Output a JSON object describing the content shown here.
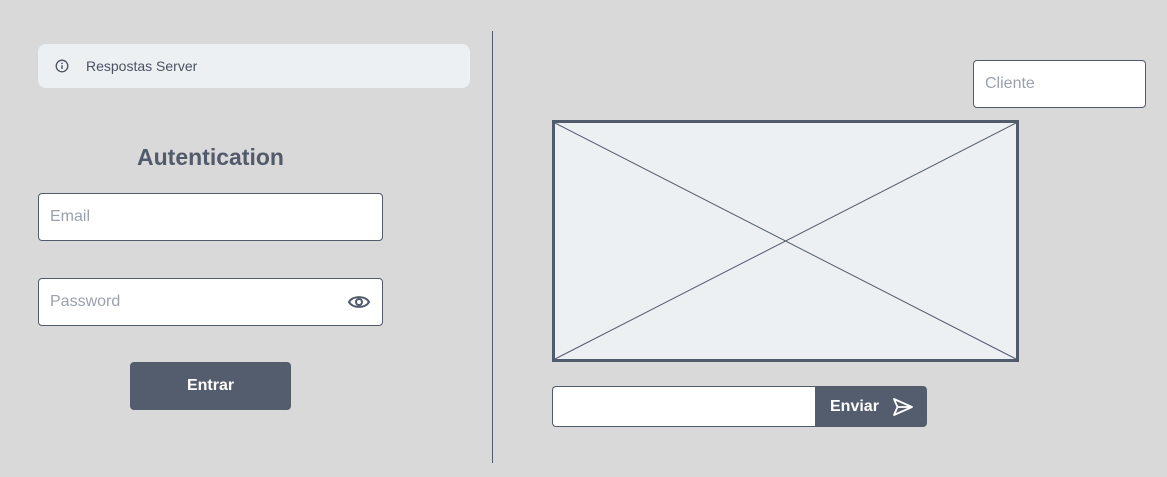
{
  "notice": {
    "text": "Respostas Server",
    "icon": "info-icon"
  },
  "auth": {
    "title": "Autentication",
    "email_placeholder": "Email",
    "email_value": "",
    "password_placeholder": "Password",
    "password_value": "",
    "toggle_icon": "eye-icon",
    "login_label": "Entrar"
  },
  "chat": {
    "client_placeholder": "Cliente",
    "client_value": "",
    "image_icon": "image-placeholder",
    "message_value": "",
    "send_label": "Enviar",
    "send_icon": "send-icon"
  },
  "colors": {
    "background": "#d9d9d9",
    "panel": "#edf0f3",
    "primary": "#545d6e",
    "border": "#525b6b"
  }
}
